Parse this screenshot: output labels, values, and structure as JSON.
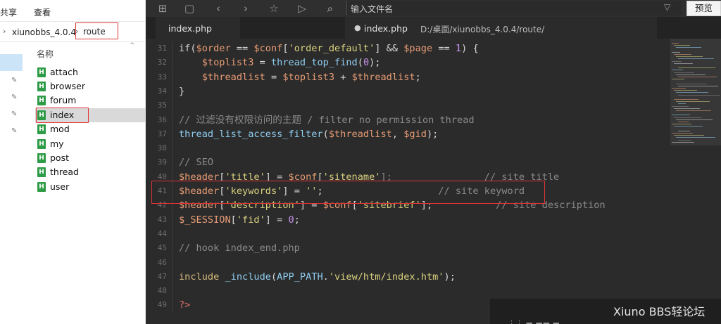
{
  "explorer": {
    "ribbon_tabs": [
      "共享",
      "查看"
    ],
    "breadcrumb": [
      "xiunobbs_4.0.4",
      "route"
    ],
    "column_header": "名称",
    "files": [
      "attach",
      "browser",
      "forum",
      "index",
      "mod",
      "my",
      "post",
      "thread",
      "user"
    ],
    "selected_file": "index",
    "file_icon": "html-file-icon"
  },
  "editor": {
    "toolbar": {
      "icons": [
        "new-file-icon",
        "save-icon",
        "back-arrow-icon",
        "forward-arrow-icon",
        "star-icon",
        "play-icon",
        "file-search-icon"
      ],
      "search_placeholder": "输入文件名",
      "preview_label": "预览"
    },
    "tabs": {
      "active": "index.php",
      "open_file_name": "index.php",
      "open_file_path": "D:/桌面/xiunobbs_4.0.4/route/"
    },
    "code_lines": [
      {
        "n": "31",
        "tokens": [
          {
            "t": "if(",
            "c": "pun"
          },
          {
            "t": "$order",
            "c": "var"
          },
          {
            "t": " == ",
            "c": "pun"
          },
          {
            "t": "$conf",
            "c": "var"
          },
          {
            "t": "[",
            "c": "pun"
          },
          {
            "t": "'order_default'",
            "c": "str"
          },
          {
            "t": "] && ",
            "c": "pun"
          },
          {
            "t": "$page",
            "c": "var"
          },
          {
            "t": " == ",
            "c": "pun"
          },
          {
            "t": "1",
            "c": "num"
          },
          {
            "t": ") {",
            "c": "pun"
          }
        ]
      },
      {
        "n": "32",
        "tokens": [
          {
            "t": "    ",
            "c": "pun"
          },
          {
            "t": "$toplist3",
            "c": "var"
          },
          {
            "t": " = ",
            "c": "pun"
          },
          {
            "t": "thread_top_find",
            "c": "fn"
          },
          {
            "t": "(",
            "c": "pun"
          },
          {
            "t": "0",
            "c": "num"
          },
          {
            "t": ");",
            "c": "pun"
          }
        ]
      },
      {
        "n": "33",
        "tokens": [
          {
            "t": "    ",
            "c": "pun"
          },
          {
            "t": "$threadlist",
            "c": "var"
          },
          {
            "t": " = ",
            "c": "pun"
          },
          {
            "t": "$toplist3",
            "c": "var"
          },
          {
            "t": " + ",
            "c": "pun"
          },
          {
            "t": "$threadlist",
            "c": "var"
          },
          {
            "t": ";",
            "c": "pun"
          }
        ]
      },
      {
        "n": "34",
        "tokens": [
          {
            "t": "}",
            "c": "pun"
          }
        ]
      },
      {
        "n": "35",
        "tokens": []
      },
      {
        "n": "36",
        "tokens": [
          {
            "t": "// 过滤没有权限访问的主题 / filter no permission thread",
            "c": "cmt"
          }
        ]
      },
      {
        "n": "37",
        "tokens": [
          {
            "t": "thread_list_access_filter",
            "c": "fn"
          },
          {
            "t": "(",
            "c": "pun"
          },
          {
            "t": "$threadlist",
            "c": "var"
          },
          {
            "t": ", ",
            "c": "pun"
          },
          {
            "t": "$gid",
            "c": "var"
          },
          {
            "t": ");",
            "c": "pun"
          }
        ]
      },
      {
        "n": "38",
        "tokens": []
      },
      {
        "n": "39",
        "tokens": [
          {
            "t": "// SEO",
            "c": "cmt"
          }
        ]
      },
      {
        "n": "40",
        "tokens": [
          {
            "t": "$header",
            "c": "var"
          },
          {
            "t": "[",
            "c": "pun"
          },
          {
            "t": "'title'",
            "c": "str"
          },
          {
            "t": "] = ",
            "c": "pun"
          },
          {
            "t": "$conf",
            "c": "var"
          },
          {
            "t": "[",
            "c": "pun"
          },
          {
            "t": "'sitename'",
            "c": "str"
          },
          {
            "t": "];                // site title",
            "c": "cmt"
          }
        ]
      },
      {
        "n": "41",
        "tokens": [
          {
            "t": "$header",
            "c": "var"
          },
          {
            "t": "[",
            "c": "pun"
          },
          {
            "t": "'keywords'",
            "c": "str"
          },
          {
            "t": "] = ",
            "c": "pun"
          },
          {
            "t": "''",
            "c": "str"
          },
          {
            "t": ";",
            "c": "pun"
          },
          {
            "t": "                    // site keyword",
            "c": "cmt"
          }
        ]
      },
      {
        "n": "42",
        "tokens": [
          {
            "t": "$header",
            "c": "var"
          },
          {
            "t": "[",
            "c": "pun"
          },
          {
            "t": "'description'",
            "c": "str"
          },
          {
            "t": "] = ",
            "c": "pun"
          },
          {
            "t": "$conf",
            "c": "var"
          },
          {
            "t": "[",
            "c": "pun"
          },
          {
            "t": "'sitebrief'",
            "c": "str"
          },
          {
            "t": "];",
            "c": "pun"
          },
          {
            "t": "           // site description",
            "c": "cmt"
          }
        ]
      },
      {
        "n": "43",
        "tokens": [
          {
            "t": "$_SESSION",
            "c": "var"
          },
          {
            "t": "[",
            "c": "pun"
          },
          {
            "t": "'fid'",
            "c": "str"
          },
          {
            "t": "] = ",
            "c": "pun"
          },
          {
            "t": "0",
            "c": "num"
          },
          {
            "t": ";",
            "c": "pun"
          }
        ]
      },
      {
        "n": "44",
        "tokens": []
      },
      {
        "n": "45",
        "tokens": [
          {
            "t": "// hook index_end.php",
            "c": "cmt"
          }
        ]
      },
      {
        "n": "46",
        "tokens": []
      },
      {
        "n": "47",
        "tokens": [
          {
            "t": "include",
            "c": "kw"
          },
          {
            "t": " ",
            "c": "pun"
          },
          {
            "t": "_include",
            "c": "fn"
          },
          {
            "t": "(",
            "c": "pun"
          },
          {
            "t": "APP_PATH",
            "c": "const"
          },
          {
            "t": ".",
            "c": "pun"
          },
          {
            "t": "'view/htm/index.htm'",
            "c": "str"
          },
          {
            "t": ");",
            "c": "pun"
          }
        ]
      },
      {
        "n": "48",
        "tokens": []
      },
      {
        "n": "49",
        "tokens": [
          {
            "t": "?>",
            "c": "tag"
          }
        ]
      }
    ],
    "highlighted_line": "41"
  },
  "watermark": {
    "text": "Xiuno BBS轻论坛"
  }
}
